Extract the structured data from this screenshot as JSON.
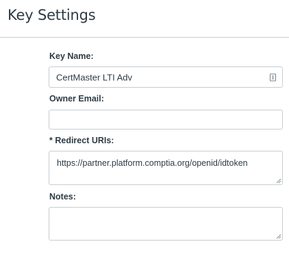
{
  "header": {
    "title": "Key Settings"
  },
  "form": {
    "key_name": {
      "label": "Key Name:",
      "value": "CertMaster LTI Adv",
      "icon": "credential-icon"
    },
    "owner_email": {
      "label": "Owner Email:",
      "value": ""
    },
    "redirect_uris": {
      "label": "* Redirect URIs:",
      "value": "https://partner.platform.comptia.org/openid/idtoken"
    },
    "notes": {
      "label": "Notes:",
      "value": ""
    }
  },
  "colors": {
    "text": "#2d3b45",
    "border": "#c7cdd1",
    "divider": "#c7cdd1"
  }
}
